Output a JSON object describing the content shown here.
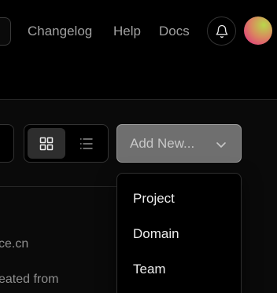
{
  "header": {
    "nav": [
      {
        "label": "Changelog"
      },
      {
        "label": "Help"
      },
      {
        "label": "Docs"
      }
    ],
    "notifications_icon": "bell-icon",
    "avatar_colors": [
      "#b8d84a",
      "#d98a5e",
      "#e0407a"
    ]
  },
  "toolbar": {
    "view_toggle": {
      "options": [
        "grid-view-icon",
        "list-view-icon"
      ],
      "selected": "grid-view-icon"
    },
    "add_new": {
      "label": "Add New...",
      "icon": "chevron-down-icon"
    }
  },
  "add_new_menu": {
    "items": [
      {
        "label": "Project"
      },
      {
        "label": "Domain"
      },
      {
        "label": "Team"
      }
    ]
  },
  "background": {
    "lines": [
      "ce.cn",
      "eated from"
    ]
  },
  "colors": {
    "page_bg": "#000000",
    "band_bg": "#0a0a0a",
    "button_bg": "#6f6f6f",
    "text": "#ededed",
    "muted_text": "#a1a1a1"
  }
}
